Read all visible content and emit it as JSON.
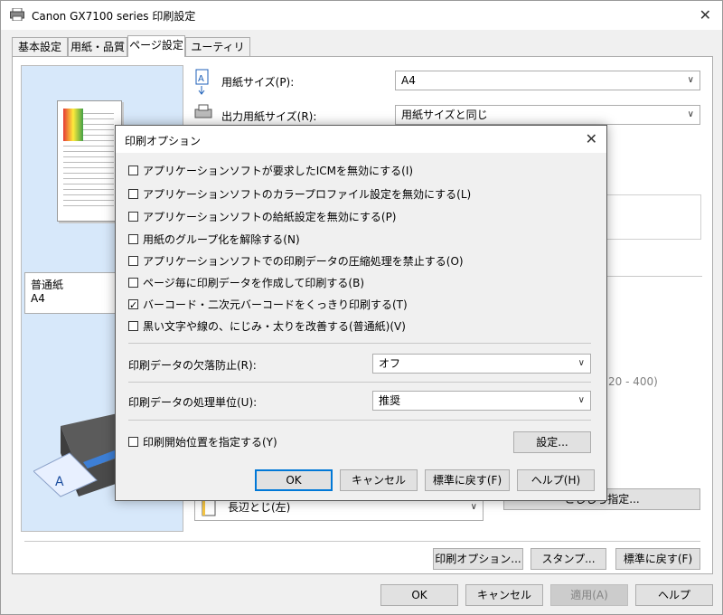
{
  "window": {
    "title": "Canon GX7100 series 印刷設定",
    "tabs": [
      "基本設定",
      "用紙・品質",
      "ページ設定",
      "ユーティリティ"
    ],
    "active_tab": 2
  },
  "page_settings": {
    "paper_size_label": "用紙サイズ(P):",
    "paper_size_value": "A4",
    "output_size_label": "出力用紙サイズ(R):",
    "output_size_value": "用紙サイズと同じ",
    "media_name": "普通紙",
    "media_size": "A4",
    "range_partial": "20 - 400)",
    "binding_value": "長辺とじ(左)",
    "margin_button_partial": "とじしろ指定...",
    "print_options_button": "印刷オプション...",
    "stamp_button": "スタンプ...",
    "default_button": "標準に戻す(F)"
  },
  "footer": {
    "ok": "OK",
    "cancel": "キャンセル",
    "apply": "適用(A)",
    "help": "ヘルプ"
  },
  "dialog": {
    "title": "印刷オプション",
    "options": [
      {
        "label": "アプリケーションソフトが要求したICMを無効にする(I)",
        "checked": false
      },
      {
        "label": "アプリケーションソフトのカラープロファイル設定を無効にする(L)",
        "checked": false
      },
      {
        "label": "アプリケーションソフトの給紙設定を無効にする(P)",
        "checked": false
      },
      {
        "label": "用紙のグループ化を解除する(N)",
        "checked": false
      },
      {
        "label": "アプリケーションソフトでの印刷データの圧縮処理を禁止する(O)",
        "checked": false
      },
      {
        "label": "ページ毎に印刷データを作成して印刷する(B)",
        "checked": false
      },
      {
        "label": "バーコード・二次元バーコードをくっきり印刷する(T)",
        "checked": true
      },
      {
        "label": "黒い文字や線の、にじみ・太りを改善する(普通紙)(V)",
        "checked": false
      }
    ],
    "dropout_label": "印刷データの欠落防止(R):",
    "dropout_value": "オフ",
    "unit_label": "印刷データの処理単位(U):",
    "unit_value": "推奨",
    "start_pos_label": "印刷開始位置を指定する(Y)",
    "start_pos_checked": false,
    "settings_button": "設定...",
    "ok": "OK",
    "cancel": "キャンセル",
    "default": "標準に戻す(F)",
    "help": "ヘルプ(H)"
  }
}
